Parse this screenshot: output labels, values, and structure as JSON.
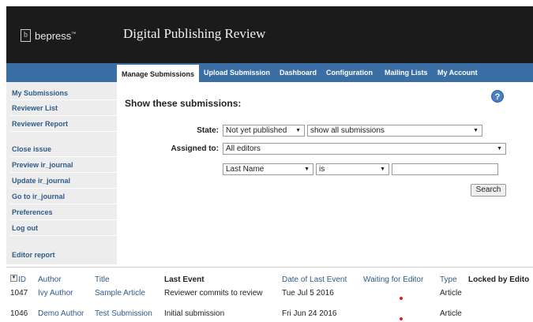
{
  "header": {
    "logo_text": "bepress",
    "logo_mark": "b",
    "logo_tm": "™",
    "site_title": "Digital Publishing Review"
  },
  "nav": {
    "items": [
      {
        "label": "Manage Submissions",
        "active": true
      },
      {
        "label": "Upload Submission"
      },
      {
        "label": "Dashboard"
      },
      {
        "label": "Configuration"
      },
      {
        "label": "Mailing Lists"
      },
      {
        "label": "My Account"
      }
    ]
  },
  "sidebar": {
    "items": [
      "My Submissions",
      "Reviewer List",
      "Reviewer Report",
      "Close issue",
      "Preview ir_journal",
      "Update ir_journal",
      "Go to ir_journal",
      "Preferences",
      "Log out",
      "Editor report"
    ]
  },
  "main": {
    "title": "Show these submissions:",
    "help_icon": "?",
    "state_label": "State:",
    "state_select": "Not yet published",
    "state_filter_select": "show all submissions",
    "assigned_label": "Assigned to:",
    "assigned_select": "All editors",
    "field_select": "Last Name",
    "operator_select": "is",
    "search_value": "",
    "search_button": "Search"
  },
  "table": {
    "headers": [
      "ID",
      "Author",
      "Title",
      "Last Event",
      "Date of Last Event",
      "Waiting for Editor",
      "Type",
      "Locked by Edito"
    ],
    "rows": [
      {
        "id": "1047",
        "author": "Ivy Author",
        "title": "Sample Article",
        "last_event": "Reviewer commits to review",
        "date": "Tue Jul 5 2016",
        "waiting": true,
        "type": "Article"
      },
      {
        "id": "1046",
        "author": "Demo Author",
        "title": "Test Submission",
        "last_event": "Initial submission",
        "date": "Fri Jun 24 2016",
        "waiting": true,
        "type": "Article"
      }
    ]
  },
  "colors": {
    "header_bg": "#1b1b1b",
    "nav_bg": "#3a6ea5",
    "sidebar_bg": "#ededed",
    "link": "#2f5b8a",
    "waiting_dot": "#e02020"
  }
}
